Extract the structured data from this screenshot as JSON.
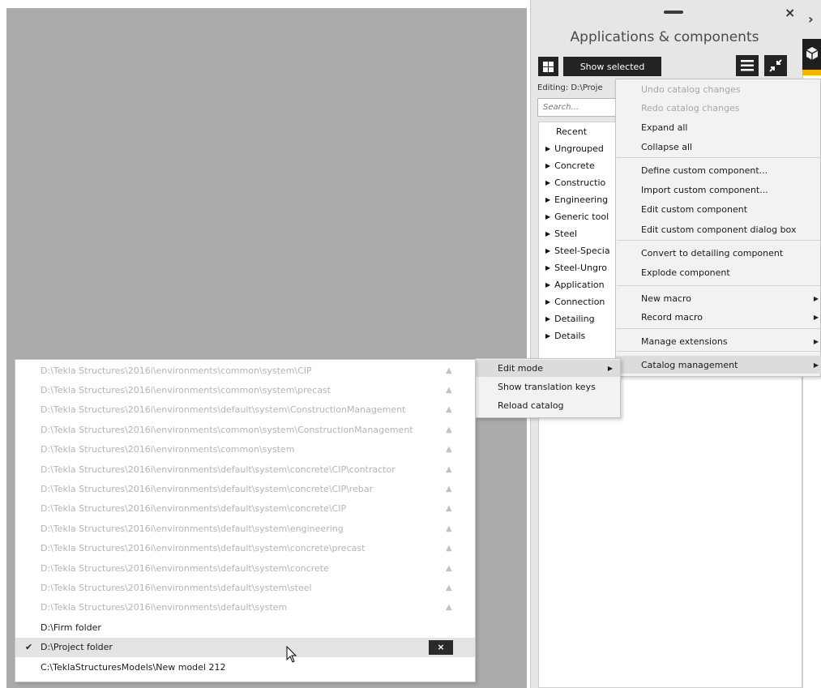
{
  "panel": {
    "title": "Applications & components",
    "close_glyph": "×",
    "arrow_glyph": "›",
    "show_selected_label": "Show selected",
    "editing_label": "Editing:  D:\\Proje",
    "search_placeholder": "Search...",
    "grid_icon": "grid-icon",
    "list_icon": "hamburger-menu-icon",
    "shrink_icon": "shrink-arrows-icon",
    "tree_items": [
      {
        "label": "Recent",
        "arrow": ""
      },
      {
        "label": "Ungrouped",
        "arrow": "▶"
      },
      {
        "label": "Concrete",
        "arrow": "▶"
      },
      {
        "label": "Constructio",
        "arrow": "▶"
      },
      {
        "label": "Engineering",
        "arrow": "▶"
      },
      {
        "label": "Generic tool",
        "arrow": "▶"
      },
      {
        "label": "Steel",
        "arrow": "▶"
      },
      {
        "label": "Steel-Specia",
        "arrow": "▶"
      },
      {
        "label": "Steel-Ungro",
        "arrow": "▶"
      },
      {
        "label": "Application",
        "arrow": "▶"
      },
      {
        "label": "Connection",
        "arrow": "▶"
      },
      {
        "label": "Detailing",
        "arrow": "▶"
      },
      {
        "label": "Details",
        "arrow": "▶"
      }
    ]
  },
  "context_menu": {
    "items": [
      {
        "label": "Undo catalog changes",
        "disabled": true
      },
      {
        "label": "Redo catalog changes",
        "disabled": true
      },
      {
        "label": "Expand all"
      },
      {
        "label": "Collapse all"
      },
      {
        "label": "Define custom component..."
      },
      {
        "label": "Import custom component..."
      },
      {
        "label": "Edit custom component"
      },
      {
        "label": "Edit custom component dialog box"
      },
      {
        "label": "Convert to detailing component"
      },
      {
        "label": "Explode component"
      },
      {
        "label": "New macro",
        "submenu": true
      },
      {
        "label": "Record macro",
        "submenu": true
      },
      {
        "label": "Manage extensions",
        "submenu": true
      },
      {
        "label": "Catalog management",
        "submenu": true,
        "highlighted": true
      }
    ],
    "submenu_arrow": "▶"
  },
  "catalog_submenu": {
    "items": [
      {
        "label": "Edit mode",
        "submenu": true,
        "highlighted": true
      },
      {
        "label": "Show translation keys"
      },
      {
        "label": "Reload catalog"
      }
    ]
  },
  "folders": {
    "warning_glyph": "▲",
    "check_glyph": "✔",
    "remove_glyph": "×",
    "rows": [
      {
        "path": "D:\\Tekla Structures\\2016i\\environments\\common\\system\\CIP",
        "disabled": true
      },
      {
        "path": "D:\\Tekla Structures\\2016i\\environments\\common\\system\\precast",
        "disabled": true
      },
      {
        "path": "D:\\Tekla Structures\\2016i\\environments\\default\\system\\ConstructionManagement",
        "disabled": true
      },
      {
        "path": "D:\\Tekla Structures\\2016i\\environments\\common\\system\\ConstructionManagement",
        "disabled": true
      },
      {
        "path": "D:\\Tekla Structures\\2016i\\environments\\common\\system",
        "disabled": true
      },
      {
        "path": "D:\\Tekla Structures\\2016i\\environments\\default\\system\\concrete\\CIP\\contractor",
        "disabled": true
      },
      {
        "path": "D:\\Tekla Structures\\2016i\\environments\\default\\system\\concrete\\CIP\\rebar",
        "disabled": true
      },
      {
        "path": "D:\\Tekla Structures\\2016i\\environments\\default\\system\\concrete\\CIP",
        "disabled": true
      },
      {
        "path": "D:\\Tekla Structures\\2016i\\environments\\default\\system\\engineering",
        "disabled": true
      },
      {
        "path": "D:\\Tekla Structures\\2016i\\environments\\default\\system\\concrete\\precast",
        "disabled": true
      },
      {
        "path": "D:\\Tekla Structures\\2016i\\environments\\default\\system\\concrete",
        "disabled": true
      },
      {
        "path": "D:\\Tekla Structures\\2016i\\environments\\default\\system\\steel",
        "disabled": true
      },
      {
        "path": "D:\\Tekla Structures\\2016i\\environments\\default\\system",
        "disabled": true
      },
      {
        "path": "D:\\Firm folder",
        "disabled": false
      },
      {
        "path": "D:\\Project folder",
        "disabled": false,
        "selected": true
      },
      {
        "path": "C:\\TeklaStructuresModels\\New model 212",
        "disabled": false
      }
    ]
  },
  "cursor_icon": "mouse-pointer-icon"
}
